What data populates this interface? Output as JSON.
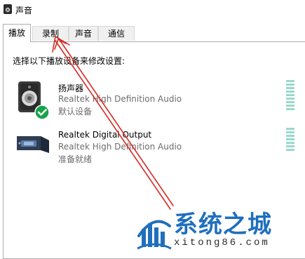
{
  "window": {
    "title": "声音",
    "title_icon": "speaker-icon"
  },
  "tabs": [
    {
      "label": "播放",
      "active": true
    },
    {
      "label": "录制",
      "active": false
    },
    {
      "label": "声音",
      "active": false
    },
    {
      "label": "通信",
      "active": false
    }
  ],
  "instruction": "选择以下播放设备来修改设置:",
  "devices": [
    {
      "name": "扬声器",
      "driver": "Realtek High Definition Audio",
      "status": "默认设备",
      "icon": "speaker-device-icon",
      "default": true
    },
    {
      "name": "Realtek Digital Output",
      "driver": "Realtek High Definition Audio",
      "status": "准备就绪",
      "icon": "digital-output-icon",
      "default": false
    }
  ],
  "watermark": {
    "text": "系统之城",
    "url": "xitong86.com",
    "logo": "castle-logo"
  },
  "colors": {
    "accent_green": "#16a34a",
    "arrow_red": "#d42a22",
    "meter": "#9bd9cc",
    "watermark_blue": "#1f6fbd"
  }
}
